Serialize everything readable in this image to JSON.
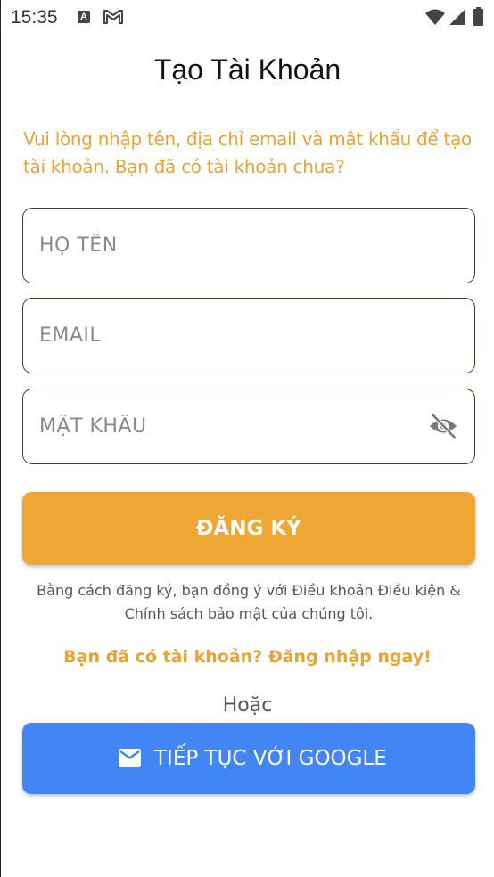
{
  "status_bar": {
    "time": "15:35",
    "icons": [
      "a-notification-icon",
      "gmail-icon",
      "wifi-icon",
      "signal-icon",
      "battery-icon"
    ]
  },
  "page": {
    "title": "Tạo Tài Khoản",
    "intro": "Vui lòng nhập tên, địa chỉ email và mật khẩu để tạo tài khoản. Bạn đã có tài khoản chưa?"
  },
  "form": {
    "name": {
      "value": "",
      "placeholder": "HỌ TÊN"
    },
    "email": {
      "value": "",
      "placeholder": "EMAIL"
    },
    "password": {
      "value": "",
      "placeholder": "MẬT KHẨU",
      "toggle_icon": "eye-off-icon"
    },
    "submit_label": "ĐĂNG KÝ"
  },
  "terms": "Bằng cách đăng ký, bạn đồng ý với Điều khoản Điều kiện & Chính sách bảo mật của chúng tôi.",
  "login_link": "Bạn đã có tài khoản? Đăng nhập ngay!",
  "divider": "Hoặc",
  "google": {
    "label": "TIẾP TỤC VỚI GOOGLE",
    "icon": "mail-icon"
  },
  "colors": {
    "accent": "#EEA735",
    "accent_text": "#E9A336",
    "google_blue": "#4285F4",
    "field_border": "#4a3a2a"
  }
}
